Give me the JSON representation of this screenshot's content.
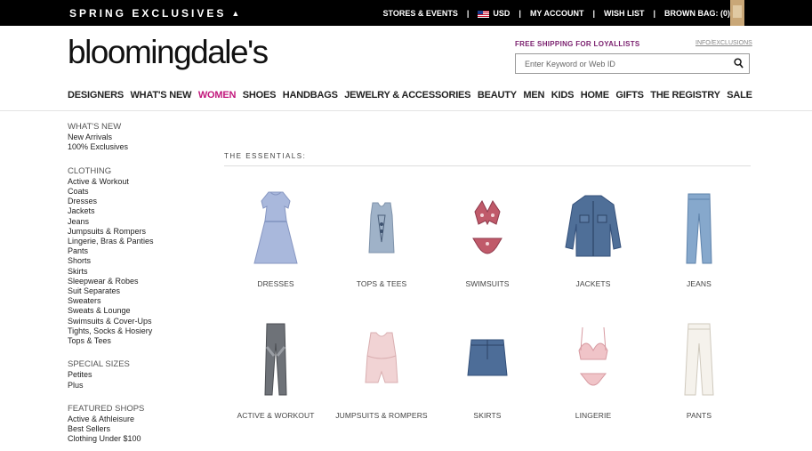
{
  "topbar": {
    "promo_label": "SPRING EXCLUSIVES",
    "stores_events": "STORES & EVENTS",
    "currency": "USD",
    "my_account": "MY ACCOUNT",
    "wish_list": "WISH LIST",
    "brown_bag": "BROWN BAG: (0)"
  },
  "header": {
    "logo": "bloomingdale's",
    "shipping_promo": "FREE SHIPPING FOR LOYALLISTS",
    "info_link": "INFO/EXCLUSIONS",
    "search_placeholder": "Enter Keyword or Web ID"
  },
  "nav": {
    "items": [
      "DESIGNERS",
      "WHAT'S NEW",
      "WOMEN",
      "SHOES",
      "HANDBAGS",
      "JEWELRY & ACCESSORIES",
      "BEAUTY",
      "MEN",
      "KIDS",
      "HOME",
      "GIFTS",
      "THE REGISTRY",
      "SALE"
    ],
    "active": "WOMEN"
  },
  "sidebar": {
    "groups": [
      {
        "heading": "WHAT'S NEW",
        "links": [
          "New Arrivals",
          "100% Exclusives"
        ]
      },
      {
        "heading": "CLOTHING",
        "links": [
          "Active & Workout",
          "Coats",
          "Dresses",
          "Jackets",
          "Jeans",
          "Jumpsuits & Rompers",
          "Lingerie, Bras & Panties",
          "Pants",
          "Shorts",
          "Skirts",
          "Sleepwear & Robes",
          "Suit Separates",
          "Sweaters",
          "Sweats & Lounge",
          "Swimsuits & Cover-Ups",
          "Tights, Socks & Hosiery",
          "Tops & Tees"
        ]
      },
      {
        "heading": "SPECIAL SIZES",
        "links": [
          "Petites",
          "Plus"
        ]
      },
      {
        "heading": "FEATURED SHOPS",
        "links": [
          "Active & Athleisure",
          "Best Sellers",
          "Clothing Under $100"
        ]
      }
    ]
  },
  "essentials": {
    "title": "THE ESSENTIALS:",
    "categories": [
      {
        "label": "DRESSES",
        "icon": "dress-icon"
      },
      {
        "label": "TOPS & TEES",
        "icon": "tank-top-icon"
      },
      {
        "label": "SWIMSUITS",
        "icon": "bikini-icon"
      },
      {
        "label": "JACKETS",
        "icon": "denim-jacket-icon"
      },
      {
        "label": "JEANS",
        "icon": "jeans-icon"
      },
      {
        "label": "ACTIVE & WORKOUT",
        "icon": "leggings-icon"
      },
      {
        "label": "JUMPSUITS & ROMPERS",
        "icon": "romper-icon"
      },
      {
        "label": "SKIRTS",
        "icon": "denim-skirt-icon"
      },
      {
        "label": "LINGERIE",
        "icon": "lingerie-icon"
      },
      {
        "label": "PANTS",
        "icon": "pants-icon"
      }
    ]
  },
  "colors": {
    "topbar_bg": "#000000",
    "accent_active_nav": "#c2187c",
    "shipping_promo": "#7a1f6e"
  }
}
